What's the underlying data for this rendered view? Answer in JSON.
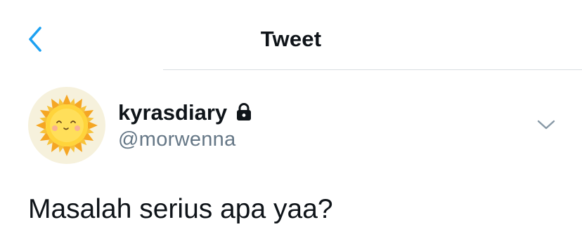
{
  "header": {
    "back_icon": "chevron-left-icon",
    "title": "Tweet",
    "accent_color": "#1da1f2"
  },
  "tweet": {
    "author": {
      "display_name": "kyrasdiary",
      "handle": "@morwenna",
      "protected_icon": "lock-icon",
      "avatar": "sun-illustration"
    },
    "menu_icon": "chevron-down-icon",
    "text": "Masalah serius apa yaa?"
  }
}
